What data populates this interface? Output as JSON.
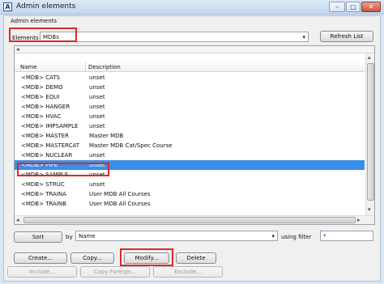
{
  "window": {
    "title": "Admin elements",
    "app_icon": "A",
    "minimize": "–",
    "maximize": "□",
    "close": "✕"
  },
  "panel": {
    "header": "Admin elements"
  },
  "elements": {
    "label": "Elements",
    "value": "MDBs",
    "refresh_label": "Refresh List"
  },
  "table": {
    "columns": [
      "Name",
      "Description"
    ],
    "rows": [
      {
        "name": "<MDB>  CATS",
        "desc": "unset"
      },
      {
        "name": "<MDB>  DEMO",
        "desc": "unset"
      },
      {
        "name": "<MDB>  EQUI",
        "desc": "unset"
      },
      {
        "name": "<MDB>  HANGER",
        "desc": "unset"
      },
      {
        "name": "<MDB>  HVAC",
        "desc": "unset"
      },
      {
        "name": "<MDB>  IMPSAMPLE",
        "desc": "unset"
      },
      {
        "name": "<MDB>  MASTER",
        "desc": "Master MDB"
      },
      {
        "name": "<MDB>  MASTERCAT",
        "desc": "Master MDB Cat/Spec Course"
      },
      {
        "name": "<MDB>  NUCLEAR",
        "desc": "unset"
      },
      {
        "name": "<MDB>  PIPE",
        "desc": "unset"
      },
      {
        "name": "<MDB>  SAMPLE",
        "desc": "unset"
      },
      {
        "name": "<MDB>  STRUC",
        "desc": "unset"
      },
      {
        "name": "<MDB>  TRAINA",
        "desc": "User MDB All Courses"
      },
      {
        "name": "<MDB>  TRAINB",
        "desc": "User MDB All Courses"
      }
    ],
    "selected_index": 9
  },
  "sort": {
    "sort_label": "Sort",
    "by_label": "by",
    "by_value": "Name",
    "filter_label": "using filter",
    "filter_value": "*"
  },
  "actions": {
    "create": "Create...",
    "copy": "Copy...",
    "modify": "Modify...",
    "delete": "Delete",
    "include": "Include...",
    "copy_foreign": "Copy Foreign...",
    "exclude": "Exclude..."
  },
  "icons": {
    "scroll_left": "◂",
    "scroll_right": "▸",
    "scroll_up": "▴",
    "scroll_down": "▾",
    "combo_arrow": "▾"
  },
  "colors": {
    "selection": "#3a8ee6",
    "highlight_box": "#e0272b"
  }
}
